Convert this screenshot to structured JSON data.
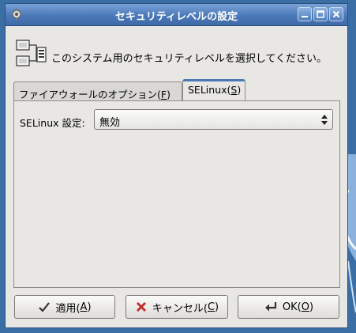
{
  "window": {
    "title": "セキュリティレベルの設定"
  },
  "header": {
    "text": "このシステム用のセキュリティレベルを選択してください。"
  },
  "tabs": [
    {
      "label_prefix": "ファイアウォールのオプション(",
      "mnemonic": "F",
      "label_suffix": ")"
    },
    {
      "label_prefix": "SELinux(",
      "mnemonic": "S",
      "label_suffix": ")"
    }
  ],
  "selinux": {
    "setting_label": "SELinux 設定:",
    "setting_value": "無効"
  },
  "buttons": {
    "apply": {
      "label_prefix": "適用(",
      "mnemonic": "A",
      "label_suffix": ")"
    },
    "cancel": {
      "label_prefix": "キャンセル(",
      "mnemonic": "C",
      "label_suffix": ")"
    },
    "ok": {
      "label_prefix": "OK(",
      "mnemonic": "O",
      "label_suffix": ")"
    }
  },
  "colors": {
    "titlebar": "#4a78b8",
    "desktop": "#3a6ea5",
    "dialog": "#e8e7e4"
  },
  "icons": {
    "titlebar": "gear-icon",
    "header": "computer-network-icon",
    "apply": "checkmark-icon",
    "cancel": "close-x-icon",
    "ok": "return-arrow-icon"
  }
}
